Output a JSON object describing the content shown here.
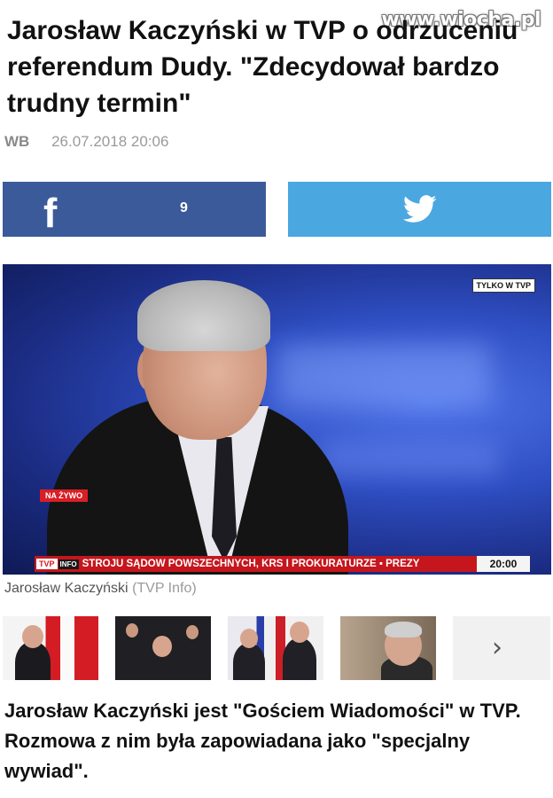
{
  "watermark": "www.wiocha.pl",
  "article": {
    "headline": "Jarosław Kaczyński w TVP o odrzuceniu referendum Dudy. \"Zdecydował bardzo trudny termin\"",
    "author": "WB",
    "date": "26.07.2018 20:06",
    "lead": "Jarosław Kaczyński jest \"Gościem Wiadomości\" w TVP. Rozmowa z nim była zapowiadana jako \"specjalny wywiad\"."
  },
  "share": {
    "facebook_icon": "f",
    "facebook_count": "9",
    "twitter_icon": "twitter-bird"
  },
  "image": {
    "tag_exclusive": "TYLKO W TVP",
    "tag_live": "NA ŻYWO",
    "ticker_logo": "TVP",
    "ticker_logo_info": "INFO",
    "ticker_text": "STROJU SĄDÓW POWSZECHNYCH, KRS I PROKURATURZE ▪ PREZY",
    "clock": "20:00",
    "caption_name": "Jarosław Kaczyński",
    "caption_source": "(TVP Info)"
  },
  "gallery": {
    "next_icon": "chevron-right"
  },
  "colors": {
    "facebook": "#3b5a9a",
    "twitter": "#4aa7e0",
    "ticker_red": "#c5161d"
  }
}
